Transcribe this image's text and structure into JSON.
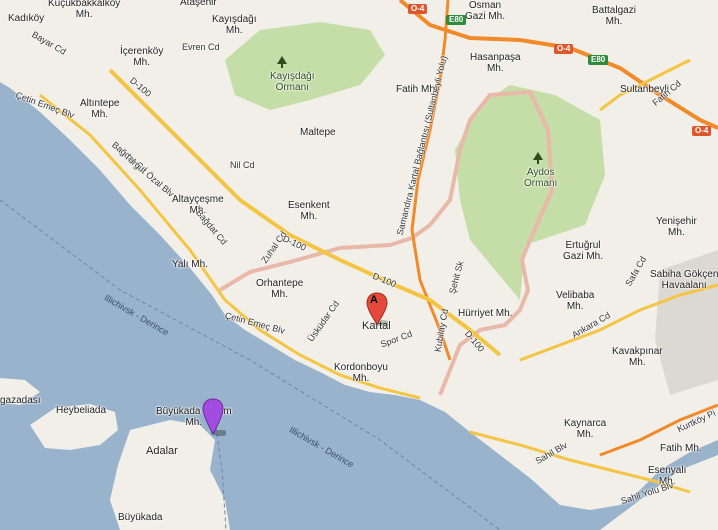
{
  "colors": {
    "water": "#99b3cc",
    "land": "#e9e5dc",
    "urban": "#f2efe9",
    "park": "#c5dea8",
    "road_major": "#f4c542",
    "road_highway": "#f08a2a",
    "district_border": "#e8b8a8",
    "marker_red": "#e34a3b",
    "marker_purple": "#a24ce0"
  },
  "markers": {
    "red": {
      "letter": "A",
      "icon": "map-pin-icon"
    },
    "purple": {
      "icon": "map-pin-icon"
    }
  },
  "labels": {
    "kucukbakkalkoy": "Küçükbakkalkoy\nMh.",
    "kadikoy": "Kadıköy",
    "atasehir": "Ataşehir",
    "kayisdagi": "Kayışdağı\nMh.",
    "icerenkoy": "İçerenköy\nMh.",
    "osman_gazi": "Osman\nGazi Mh.",
    "battalgazi": "Battalgazi\nMh.",
    "hasanpasa": "Hasanpaşa\nMh.",
    "sultanbeyli": "Sultanbeyli",
    "fatih_top": "Fatih Mh.",
    "altintepe": "Altıntepe\nMh.",
    "maltepe": "Maltepe",
    "aydos": "Aydos\nOrmanı",
    "kayisdagi_ormani": "Kayışdağı\nOrmanı",
    "altaycesme": "Altayçeşme\nMh.",
    "esenkent": "Esenkent\nMh.",
    "yenisehir": "Yenişehir\nMh.",
    "ertugrul_gazi": "Ertuğrul\nGazi Mh.",
    "sabiha": "Sabiha Gökçen\nHavaalanı",
    "yali": "Yalı Mh.",
    "orhantepe": "Orhantepe\nMh.",
    "kartal": "Kartal",
    "velibaba": "Velibaba\nMh.",
    "hurriyet": "Hürriyet Mh.",
    "kavakpinar": "Kavakpınar\nMh.",
    "kordonboyu": "Kordonboyu\nMh.",
    "heybeliada": "Heybeliada",
    "buyukada_nizam": "Büyükada Nizam\nMh.",
    "adalar": "Adalar",
    "buyukada": "Büyükada",
    "kaynarca": "Kaynarca\nMh.",
    "fatih_bottom": "Fatih Mh.",
    "esenyali": "Esenyalı\nMh.",
    "burgazadasi": "gazadası"
  },
  "roads": {
    "evren": "Evren Cd",
    "bayar": "Bayar Cd",
    "cetin_top": "Çetin Emeç Blv",
    "d100_a": "D-100",
    "bagdat_a": "Bağdat Cd",
    "turgut": "Turgut Özal Blv",
    "nil": "Nil Cd",
    "bagdat_b": "Bağdat Cd",
    "zuhal": "Zuhal Cd",
    "d100_b": "D-100",
    "d100_c": "D-100",
    "cetin_bottom": "Çetin Emeç Blv",
    "uskudar": "Üsküdar Cd",
    "spor": "Spor Cd",
    "kubilay": "Kubilay Cd",
    "sehit": "Şehit Sk",
    "d100_d": "D-100",
    "samandira": "Samandıra Kartal Bağlantısı (Sultanbeyli Yolu)",
    "fatih_cd": "Fatih Cd",
    "ankara": "Ankara Cd",
    "safa": "Safa Cd",
    "sahil": "Sahil Blv",
    "sahil_yolu": "Sahil Yolu Blv",
    "kurtkoy": "Kurtköy Pi",
    "ferry_a": "Illichivsk - Derince",
    "ferry_b": "Illichivsk - Derince"
  },
  "shields": {
    "o4_a": "O-4",
    "e80_a": "E80",
    "o4_b": "O-4",
    "e80_b": "E80",
    "o4_c": "O-4"
  }
}
